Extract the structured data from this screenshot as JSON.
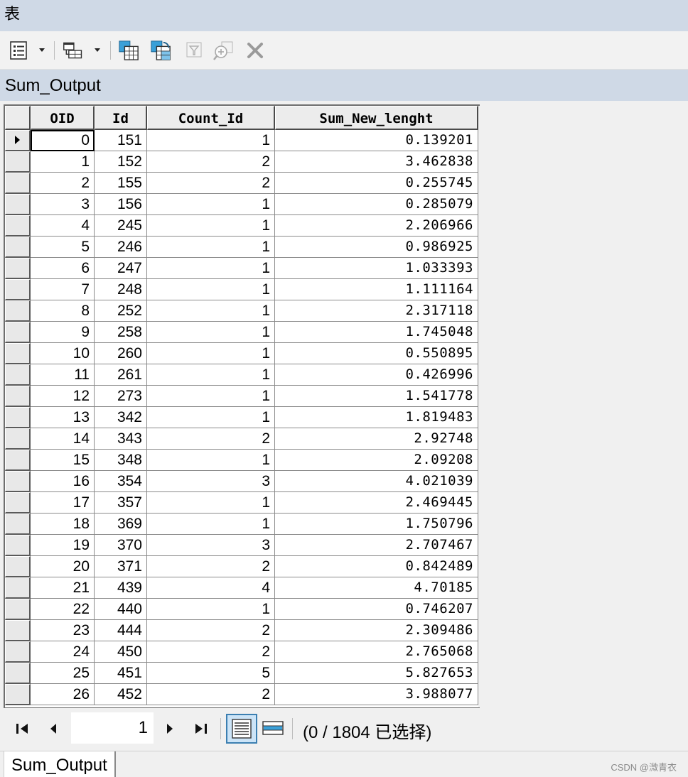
{
  "window": {
    "title": "表"
  },
  "table": {
    "name": "Sum_Output"
  },
  "columns": [
    "OID",
    "Id",
    "Count_Id",
    "Sum_New_lenght"
  ],
  "rows": [
    [
      "0",
      "151",
      "1",
      "0.139201"
    ],
    [
      "1",
      "152",
      "2",
      "3.462838"
    ],
    [
      "2",
      "155",
      "2",
      "0.255745"
    ],
    [
      "3",
      "156",
      "1",
      "0.285079"
    ],
    [
      "4",
      "245",
      "1",
      "2.206966"
    ],
    [
      "5",
      "246",
      "1",
      "0.986925"
    ],
    [
      "6",
      "247",
      "1",
      "1.033393"
    ],
    [
      "7",
      "248",
      "1",
      "1.111164"
    ],
    [
      "8",
      "252",
      "1",
      "2.317118"
    ],
    [
      "9",
      "258",
      "1",
      "1.745048"
    ],
    [
      "10",
      "260",
      "1",
      "0.550895"
    ],
    [
      "11",
      "261",
      "1",
      "0.426996"
    ],
    [
      "12",
      "273",
      "1",
      "1.541778"
    ],
    [
      "13",
      "342",
      "1",
      "1.819483"
    ],
    [
      "14",
      "343",
      "2",
      "2.92748"
    ],
    [
      "15",
      "348",
      "1",
      "2.09208"
    ],
    [
      "16",
      "354",
      "3",
      "4.021039"
    ],
    [
      "17",
      "357",
      "1",
      "2.469445"
    ],
    [
      "18",
      "369",
      "1",
      "1.750796"
    ],
    [
      "19",
      "370",
      "3",
      "2.707467"
    ],
    [
      "20",
      "371",
      "2",
      "0.842489"
    ],
    [
      "21",
      "439",
      "4",
      "4.70185"
    ],
    [
      "22",
      "440",
      "1",
      "0.746207"
    ],
    [
      "23",
      "444",
      "2",
      "2.309486"
    ],
    [
      "24",
      "450",
      "2",
      "2.765068"
    ],
    [
      "25",
      "451",
      "5",
      "5.827653"
    ],
    [
      "26",
      "452",
      "2",
      "3.988077"
    ]
  ],
  "navigation": {
    "current_record": "1",
    "selection_status": "(0 / 1804 已选择)"
  },
  "tabs": [
    {
      "label": "Sum_Output"
    }
  ],
  "watermark": "CSDN @溦青衣",
  "toolbar_icons": [
    "table-options-icon",
    "related-tables-icon",
    "select-by-attributes-icon",
    "switch-selection-icon",
    "clear-selection-icon",
    "zoom-to-selected-icon",
    "delete-selected-icon"
  ],
  "colors": {
    "titlebar": "#cfd9e6",
    "active_view": "#cce4f7"
  }
}
